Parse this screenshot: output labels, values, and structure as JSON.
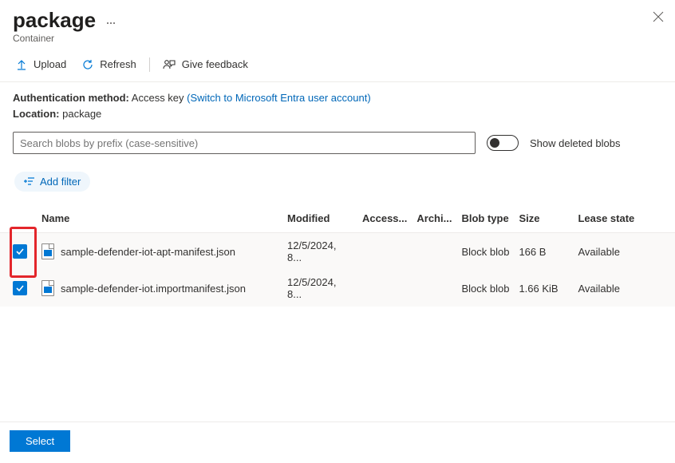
{
  "header": {
    "title": "package",
    "subtitle": "Container"
  },
  "toolbar": {
    "upload_label": "Upload",
    "refresh_label": "Refresh",
    "feedback_label": "Give feedback"
  },
  "meta": {
    "auth_label": "Authentication method:",
    "auth_value": "Access key",
    "auth_link": "(Switch to Microsoft Entra user account)",
    "location_label": "Location:",
    "location_value": "package"
  },
  "search": {
    "placeholder": "Search blobs by prefix (case-sensitive)",
    "toggle_label": "Show deleted blobs"
  },
  "filter": {
    "add_filter_label": "Add filter"
  },
  "table": {
    "headers": {
      "name": "Name",
      "modified": "Modified",
      "access": "Access...",
      "archive": "Archi...",
      "blob_type": "Blob type",
      "size": "Size",
      "lease": "Lease state"
    },
    "rows": [
      {
        "name": "sample-defender-iot-apt-manifest.json",
        "modified": "12/5/2024, 8...",
        "access": "",
        "archive": "",
        "blob_type": "Block blob",
        "size": "166 B",
        "lease": "Available"
      },
      {
        "name": "sample-defender-iot.importmanifest.json",
        "modified": "12/5/2024, 8...",
        "access": "",
        "archive": "",
        "blob_type": "Block blob",
        "size": "1.66 KiB",
        "lease": "Available"
      }
    ]
  },
  "footer": {
    "select_label": "Select"
  }
}
